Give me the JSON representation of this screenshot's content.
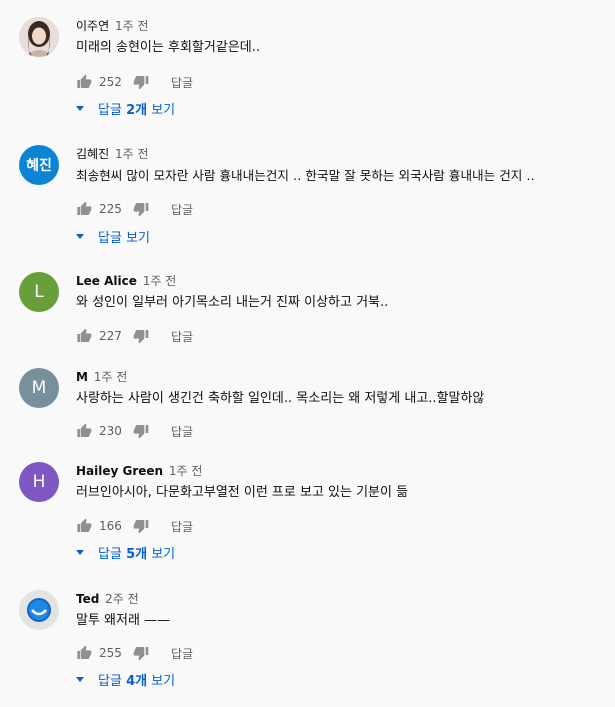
{
  "comments": [
    {
      "author": "이주연",
      "time": "1주 전",
      "text": "미래의 송현이는 후회할거같은데..",
      "likes": "252",
      "reply_label": "답글",
      "replies_prefix": "답글 ",
      "replies_count": "2개",
      "replies_suffix": " 보기",
      "avatar_type": "photo"
    },
    {
      "author": "김혜진",
      "time": "1주 전",
      "text": "최송현씨 많이 모자란 사람 흉내내는건지 ‥ 한국말 잘 못하는 외국사람 흉내내는 건지 ‥",
      "likes": "225",
      "reply_label": "답글",
      "replies_full": "답글 보기",
      "avatar_text": "혜진",
      "avatar_color": "#0b84d6"
    },
    {
      "author": "Lee Alice",
      "time": "1주 전",
      "text": "와 성인이 일부러 아기목소리 내는거 진짜 이상하고 거북..",
      "likes": "227",
      "reply_label": "답글",
      "avatar_text": "L",
      "avatar_color": "#689f38"
    },
    {
      "author": "M",
      "time": "1주 전",
      "text": "사랑하는 사람이 생긴건 축하할 일인데.. 목소리는 왜 저렇게 내고..할말하않",
      "likes": "230",
      "reply_label": "답글",
      "avatar_text": "M",
      "avatar_color": "#78909c"
    },
    {
      "author": "Hailey Green",
      "time": "1주 전",
      "text": "러브인아시아, 다문화고부열전 이런 프로 보고 있는 기분이 듦",
      "likes": "166",
      "reply_label": "답글",
      "replies_prefix": "답글 ",
      "replies_count": "5개",
      "replies_suffix": " 보기",
      "avatar_text": "H",
      "avatar_color": "#7e57c2"
    },
    {
      "author": "Ted",
      "time": "2주 전",
      "text": "말투 왜저래 ——",
      "likes": "255",
      "reply_label": "답글",
      "replies_prefix": "답글 ",
      "replies_count": "4개",
      "replies_suffix": " 보기",
      "avatar_type": "logo"
    }
  ]
}
